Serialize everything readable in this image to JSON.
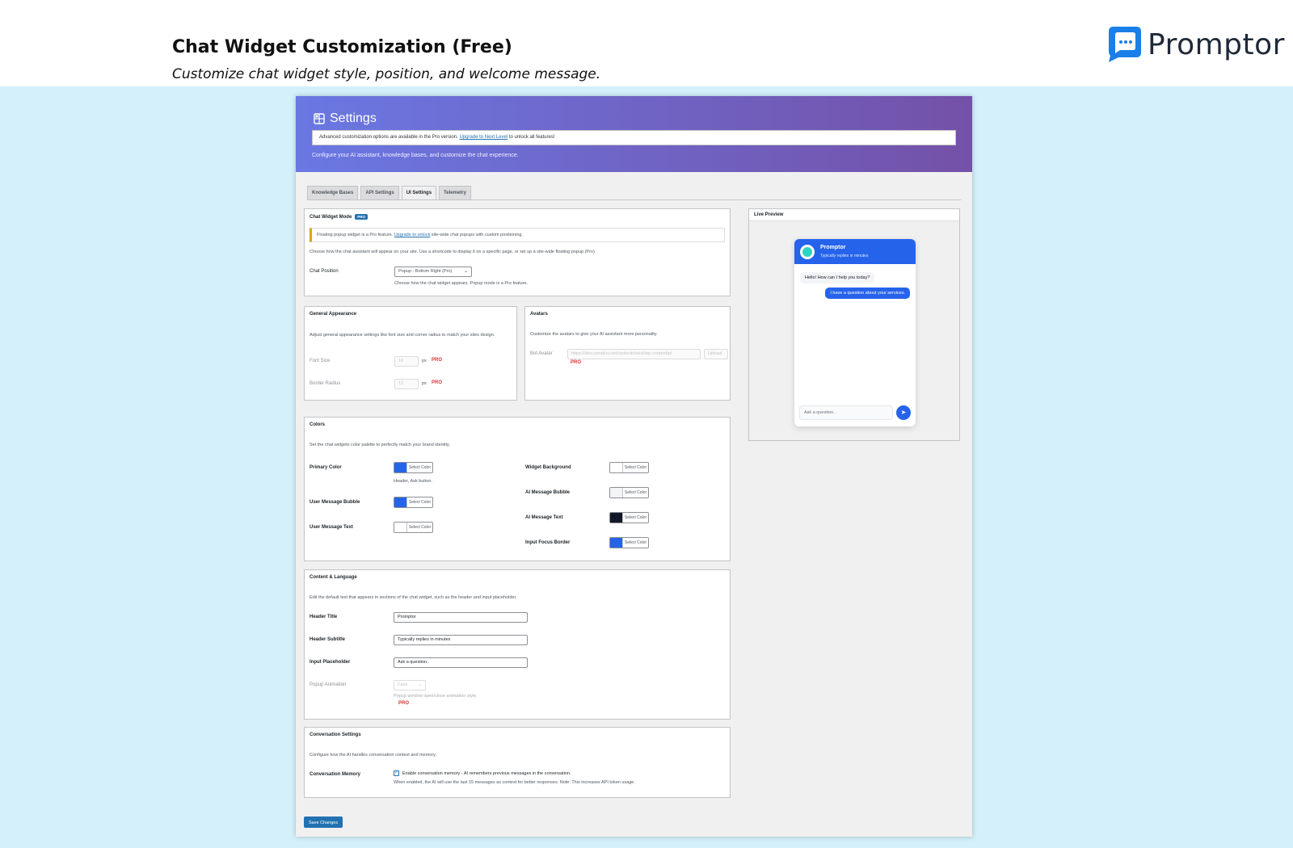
{
  "banner": {
    "title": "Chat Widget Customization (Free)",
    "subtitle": "Customize chat widget style, position, and welcome message.",
    "brand_name": "Promptor"
  },
  "hero": {
    "title": "Settings",
    "notice_prefix": "Advanced customization options are available in the Pro version. ",
    "notice_link": "Upgrade to Next Level",
    "notice_suffix": " to unlock all features!",
    "description": "Configure your AI assistant, knowledge bases, and customize the chat experience."
  },
  "tabs": [
    {
      "label": "Knowledge Bases"
    },
    {
      "label": "API Settings"
    },
    {
      "label": "UI Settings",
      "active": true
    },
    {
      "label": "Telemetry"
    }
  ],
  "widget_mode": {
    "title": "Chat Widget Mode",
    "badge": "PRO",
    "notice_prefix": "Floating popup widget is a Pro feature. ",
    "notice_link": "Upgrade to unlock",
    "notice_suffix": " site-wide chat popups with custom positioning.",
    "description": "Choose how the chat assistant will appear on your site. Use a shortcode to display it on a specific page, or set up a site-wide floating popup (Pro).",
    "position_label": "Chat Position",
    "position_value": "Popup - Bottom Right (Pro)",
    "position_help": "Choose how the chat widget appears. Popup mode is a Pro feature."
  },
  "general": {
    "title": "General Appearance",
    "description": "Adjust general appearance settings like font size and corner radius to match your sites design.",
    "font_size_label": "Font Size",
    "font_size_value": "16",
    "border_radius_label": "Border Radius",
    "border_radius_value": "12",
    "unit": "px",
    "pro": "PRO"
  },
  "avatars": {
    "title": "Avatars",
    "description": "Customize the avatars to give your AI assistant more personality.",
    "bot_label": "Bot Avatar",
    "bot_value": "https://dev.compluv.net/contentcheck/wp-content/pl",
    "upload_label": "Upload",
    "pro": "PRO"
  },
  "colors": {
    "title": "Colors",
    "description": "Set the chat widgets color palette to perfectly match your brand identity.",
    "select_label": "Select Color",
    "primary_label": "Primary Color",
    "primary_help": "Header, Ask button.",
    "user_bubble_label": "User Message Bubble",
    "user_text_label": "User Message Text",
    "widget_bg_label": "Widget Background",
    "ai_bubble_label": "AI Message Bubble",
    "ai_text_label": "AI Message Text",
    "focus_border_label": "Input Focus Border",
    "primary_hex": "#2563eb",
    "user_bubble_hex": "#2563eb",
    "user_text_hex": "#ffffff",
    "widget_bg_hex": "#ffffff",
    "ai_bubble_hex": "#f3f4f6",
    "ai_text_hex": "#111827",
    "focus_border_hex": "#2563eb"
  },
  "content": {
    "title": "Content & Language",
    "description": "Edit the default text that appears in sections of the chat widget, such as the header and input placeholder.",
    "header_title_label": "Header Title",
    "header_title_value": "Promptor",
    "header_subtitle_label": "Header Subtitle",
    "header_subtitle_value": "Typically replies in minutes",
    "input_placeholder_label": "Input Placeholder",
    "input_placeholder_value": "Ask a question..",
    "popup_animation_label": "Popup Animation",
    "popup_animation_value": "Fade",
    "popup_animation_help": "Popup window open/close animation style.",
    "pro": "PRO"
  },
  "conversation": {
    "title": "Conversation Settings",
    "description": "Configure how the AI handles conversation context and memory.",
    "memory_label": "Conversation Memory",
    "memory_checkbox": "Enable conversation memory - AI remembers previous messages in the conversation.",
    "memory_help": "When enabled, the AI will use the last 15 messages as context for better responses. Note: This increases API token usage."
  },
  "save_label": "Save Changes",
  "preview": {
    "title": "Live Preview",
    "widget_title": "Promptor",
    "widget_subtitle": "Typically replies in minutes",
    "ai_message": "Hello! How can I help you today?",
    "user_message": "I have a question about your services.",
    "input_placeholder": "Ask a question.."
  }
}
